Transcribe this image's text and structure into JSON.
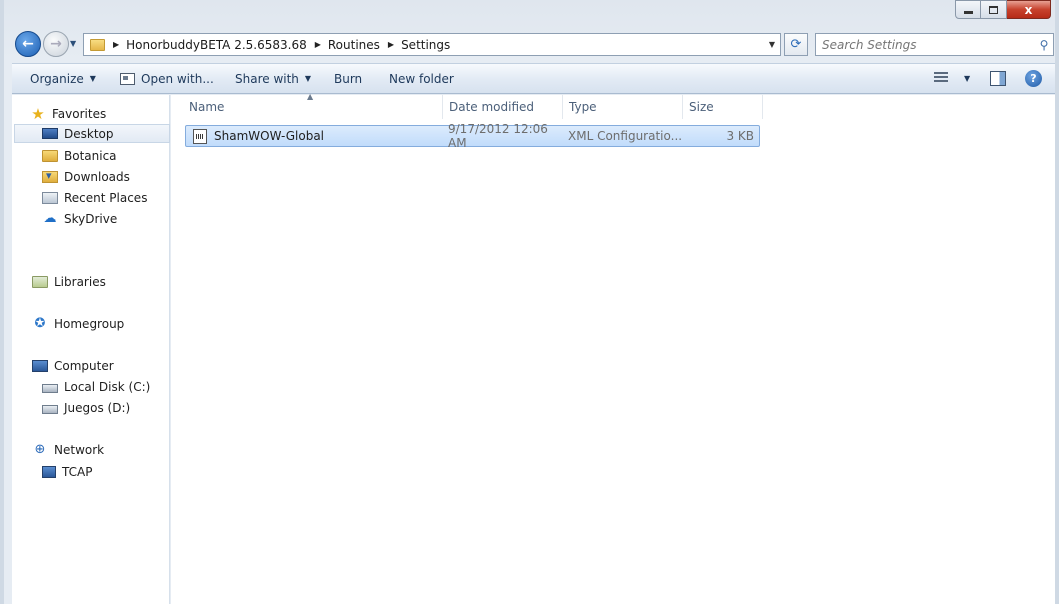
{
  "window": {
    "caption_buttons": {
      "minimize": "",
      "maximize": "",
      "close": "x"
    }
  },
  "address": {
    "crumbs": [
      "HonorbuddyBETA 2.5.6583.68",
      "Routines",
      "Settings"
    ]
  },
  "search": {
    "placeholder": "Search Settings"
  },
  "toolbar": {
    "organize": "Organize",
    "open_with": "Open with...",
    "share_with": "Share with",
    "burn": "Burn",
    "new_folder": "New folder",
    "help": "?"
  },
  "nav": {
    "favorites": "Favorites",
    "desktop": "Desktop",
    "botanica": "Botanica",
    "downloads": "Downloads",
    "recent_places": "Recent Places",
    "skydrive": "SkyDrive",
    "libraries": "Libraries",
    "homegroup": "Homegroup",
    "computer": "Computer",
    "local_disk": "Local Disk (C:)",
    "juegos": "Juegos (D:)",
    "network": "Network",
    "tcap": "TCAP"
  },
  "columns": {
    "name": "Name",
    "date": "Date modified",
    "type": "Type",
    "size": "Size"
  },
  "files": [
    {
      "name": "ShamWOW-Global",
      "date": "9/17/2012 12:06 AM",
      "type": "XML Configuratio...",
      "size": "3 KB"
    }
  ],
  "colors": {
    "accent": "#1c5fb3",
    "selection": "#c1dcfb",
    "toolbar_text": "#1e395b"
  }
}
